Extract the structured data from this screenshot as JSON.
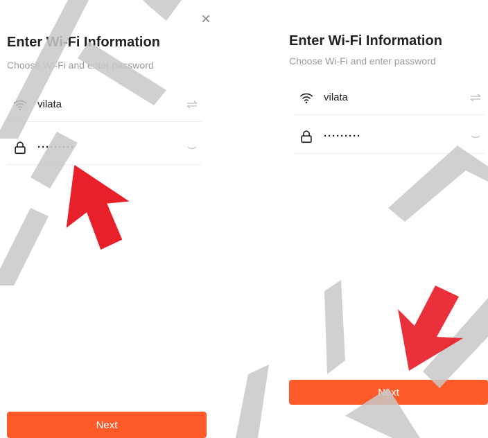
{
  "screens": [
    {
      "close_label": "×",
      "title": "Enter Wi-Fi Information",
      "subtitle": "Choose Wi-Fi and enter password",
      "ssid": {
        "icon": "wifi-icon",
        "value": "vilata",
        "action_icon": "switch-arrows-icon"
      },
      "password": {
        "icon": "lock-icon",
        "value": "·········",
        "action_icon": "eye-closed-icon"
      },
      "next_label": "Next"
    },
    {
      "close_label": "×",
      "title": "Enter Wi-Fi Information",
      "subtitle": "Choose Wi-Fi and enter password",
      "ssid": {
        "icon": "wifi-icon",
        "value": "vilata",
        "action_icon": "switch-arrows-icon"
      },
      "password": {
        "icon": "lock-icon",
        "value": "·········",
        "action_icon": "eye-closed-icon"
      },
      "next_label": "Next"
    }
  ],
  "colors": {
    "accent": "#ff5a29",
    "annotation_arrow": "#e8202a",
    "watermark": "#c8c8c8"
  },
  "annotations": {
    "left_arrow_icon": "red-arrow-up-left-icon",
    "right_arrow_icon": "red-arrow-down-left-icon"
  }
}
